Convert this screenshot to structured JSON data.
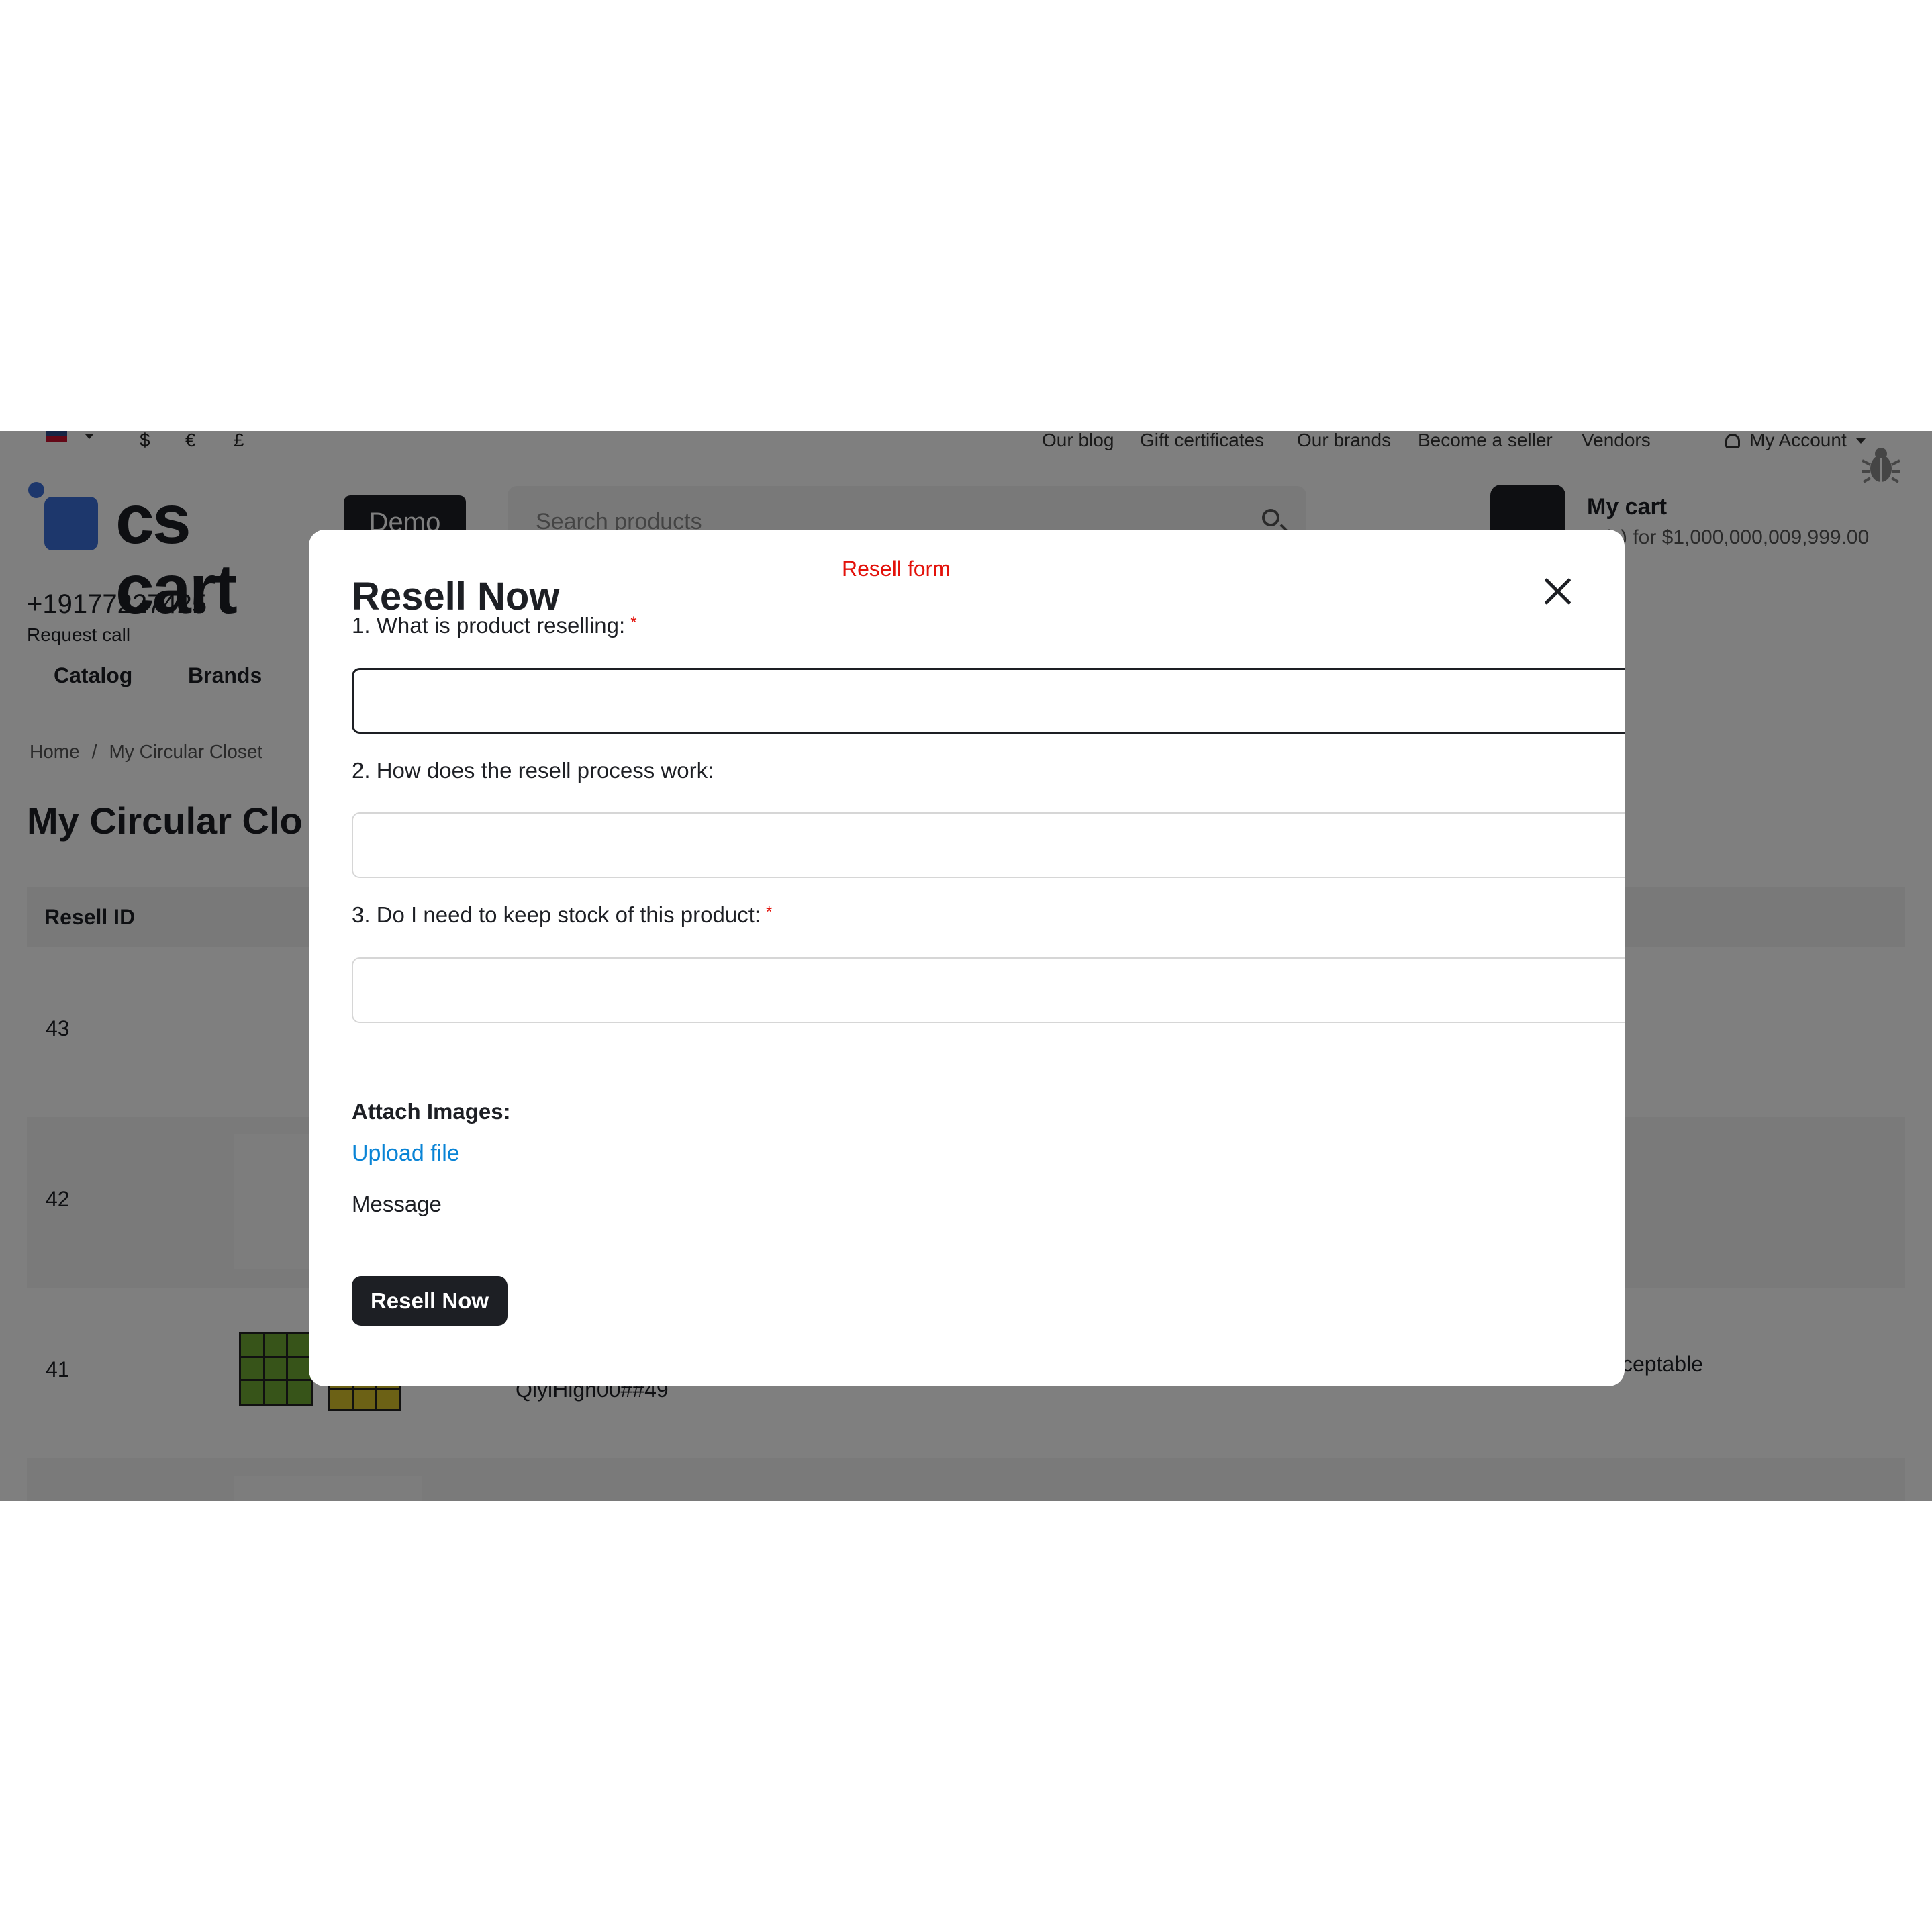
{
  "topbar": {
    "currencies": [
      "$",
      "€",
      "£"
    ],
    "links": [
      "Our blog",
      "Gift certificates",
      "Our brands",
      "Become a seller",
      "Vendors"
    ],
    "account_label": "My Account"
  },
  "header": {
    "logo_text": "cs cart",
    "demo_badge": "Demo",
    "search_placeholder": "Search products",
    "cart_title": "My cart",
    "cart_sub": "m(s) for $1,000,000,009,999.00",
    "phone": "+19177227425",
    "request_call": "Request call"
  },
  "nav": {
    "items": [
      "Catalog",
      "Brands"
    ]
  },
  "breadcrumb": {
    "home": "Home",
    "separator": "/",
    "current": "My Circular Closet"
  },
  "page": {
    "title": "My Circular Clo",
    "table_header": "Resell ID",
    "rows": [
      {
        "id": "43"
      },
      {
        "id": "42"
      },
      {
        "id": "41",
        "name": "QiyiHigh00##49",
        "condition": "cceptable"
      }
    ]
  },
  "modal": {
    "title": "Resell Now",
    "tag": "Resell form",
    "q1_label": "1. What is product reselling:",
    "q2_label": "2. How does the resell process work:",
    "q3_label": "3. Do I need to keep stock of this product:",
    "required_mark": "*",
    "q1_value": "",
    "q2_value": "",
    "q3_value": "",
    "attach_label": "Attach Images:",
    "upload_label": "Upload file",
    "message_label": "Message",
    "submit_label": "Resell Now"
  },
  "colors": {
    "accent": "#1d1f24",
    "required": "#e3120b",
    "link": "#0a84d6",
    "brand": "#3b6fd8"
  }
}
